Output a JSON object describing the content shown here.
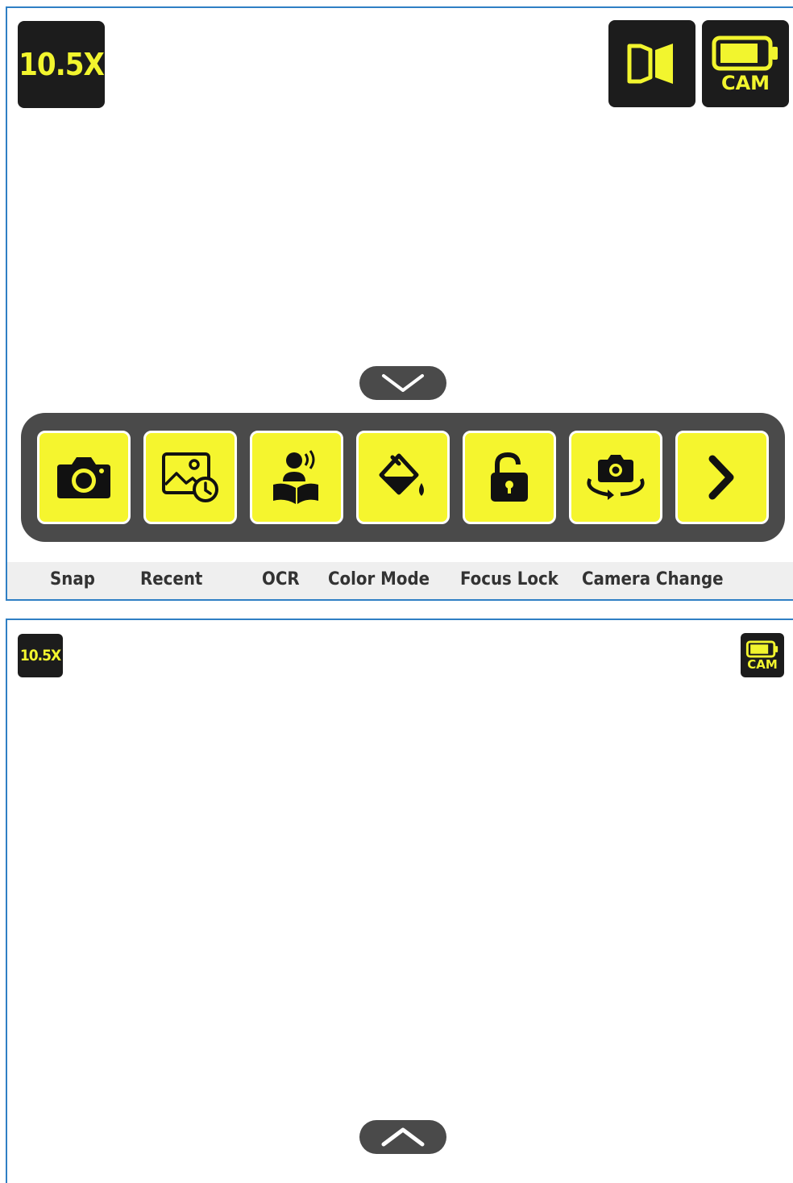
{
  "expanded_view": {
    "zoom_level": "10.5X",
    "camera_button_label": "CAM",
    "toolbar": {
      "items": [
        {
          "label": "Snap",
          "icon": "camera-icon"
        },
        {
          "label": "Recent",
          "icon": "recent-images-icon"
        },
        {
          "label": "OCR",
          "icon": "reading-person-icon"
        },
        {
          "label": "Color Mode",
          "icon": "paint-bucket-icon"
        },
        {
          "label": "Focus Lock",
          "icon": "unlocked-padlock-icon"
        },
        {
          "label": "Camera Change",
          "icon": "camera-rotate-icon"
        },
        {
          "label": "",
          "icon": "chevron-right-icon"
        }
      ]
    },
    "collapse_icon": "chevron-down-icon",
    "split_view_icon": "split-view-icon",
    "battery_icon": "battery-icon"
  },
  "collapsed_view": {
    "zoom_level": "10.5X",
    "camera_button_label": "CAM",
    "expand_icon": "chevron-up-icon"
  },
  "colors": {
    "accent_yellow": "#f5f52e",
    "dark": "#1c1c1c",
    "toolbar_gray": "#4a4a4a",
    "frame_blue": "#2f7fc4"
  }
}
